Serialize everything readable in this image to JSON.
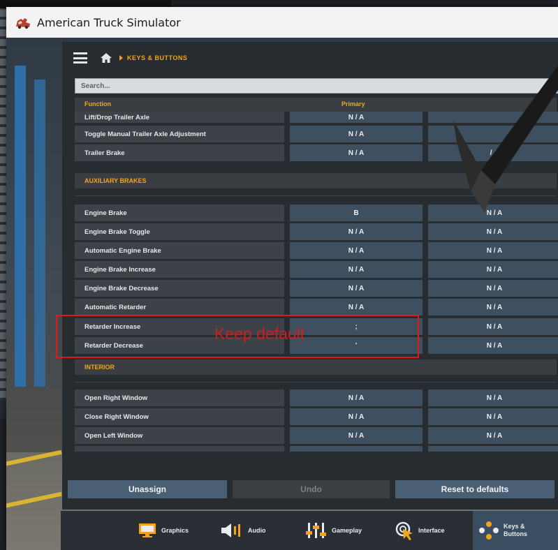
{
  "window": {
    "title": "American Truck Simulator"
  },
  "header": {
    "breadcrumb": "KEYS & BUTTONS"
  },
  "search": {
    "placeholder": "Search..."
  },
  "table": {
    "col_function": "Function",
    "col_primary": "Primary"
  },
  "rows_top": [
    {
      "function": "Lift/Drop Trailer Axle",
      "primary": "N / A",
      "secondary": ""
    },
    {
      "function": "Toggle Manual Trailer Axle Adjustment",
      "primary": "N / A",
      "secondary": ""
    },
    {
      "function": "Trailer Brake",
      "primary": "N / A",
      "secondary": "/ A"
    }
  ],
  "sections": [
    {
      "title": "AUXILIARY BRAKES"
    },
    {
      "title": "INTERIOR"
    }
  ],
  "rows_aux": [
    {
      "function": "Engine Brake",
      "primary": "B",
      "secondary": "N / A"
    },
    {
      "function": "Engine Brake Toggle",
      "primary": "N / A",
      "secondary": "N / A"
    },
    {
      "function": "Automatic Engine Brake",
      "primary": "N / A",
      "secondary": "N / A"
    },
    {
      "function": "Engine Brake Increase",
      "primary": "N / A",
      "secondary": "N / A"
    },
    {
      "function": "Engine Brake Decrease",
      "primary": "N / A",
      "secondary": "N / A"
    },
    {
      "function": "Automatic Retarder",
      "primary": "N / A",
      "secondary": "N / A"
    },
    {
      "function": "Retarder Increase",
      "primary": ";",
      "secondary": "N / A"
    },
    {
      "function": "Retarder Decrease",
      "primary": "'",
      "secondary": "N / A"
    }
  ],
  "rows_interior": [
    {
      "function": "Open Right Window",
      "primary": "N / A",
      "secondary": "N / A"
    },
    {
      "function": "Close Right Window",
      "primary": "N / A",
      "secondary": "N / A"
    },
    {
      "function": "Open Left Window",
      "primary": "N / A",
      "secondary": "N / A"
    }
  ],
  "annotation": {
    "text": "Keep default"
  },
  "buttons": {
    "unassign": "Unassign",
    "undo": "Undo",
    "reset": "Reset to defaults"
  },
  "tabs": [
    {
      "label": "Graphics",
      "icon": "monitor-icon"
    },
    {
      "label": "Audio",
      "icon": "speaker-icon"
    },
    {
      "label": "Gameplay",
      "icon": "sliders-icon"
    },
    {
      "label": "Interface",
      "icon": "cursor-icon"
    },
    {
      "label": "Keys &\nButtons",
      "icon": "gamepad-icon"
    }
  ],
  "colors": {
    "accent": "#f2a51a",
    "annotation": "#e01a1a",
    "key_cell": "#3e4f60"
  }
}
